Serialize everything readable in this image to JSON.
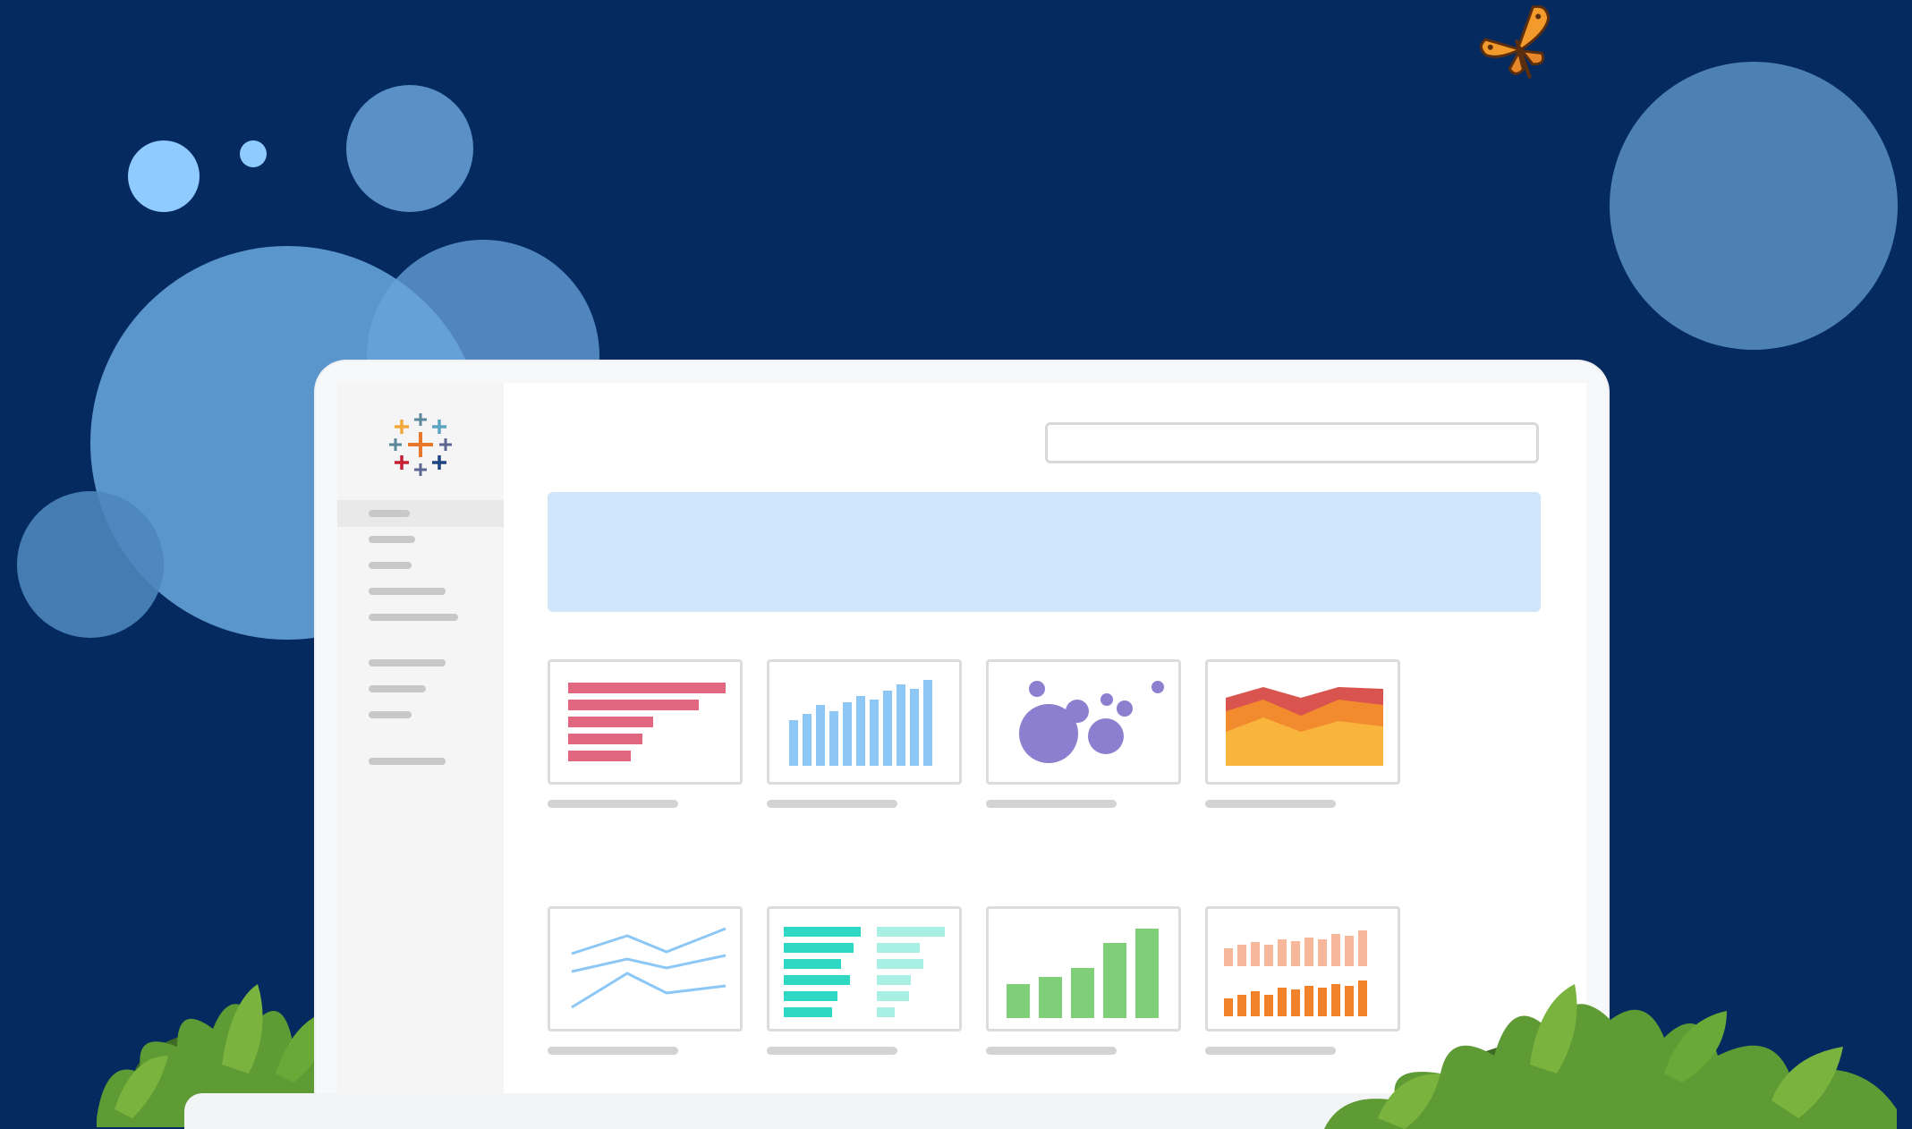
{
  "colors": {
    "background": "#042a60",
    "bubble_light": "#8fcbff",
    "bubble_mid": "#6aa3d8",
    "banner": "#cfe5f9",
    "bar_red": "#e0677f",
    "bar_blue": "#8cc7f5",
    "bubble_purple": "#8c7fd0",
    "area_red": "#d9534f",
    "area_orange": "#f28a2e",
    "area_yellow": "#f9b43c",
    "line_blue": "#8cc7f5",
    "teal": "#2ed8c3",
    "teal_light": "#a8efe4",
    "green": "#7fce78",
    "orange": "#f2822a",
    "peach": "#f7b79b"
  },
  "icons": {
    "logo": "tableau-logo-icon",
    "butterfly": "butterfly-icon",
    "foliage": "bush-icon"
  },
  "search": {
    "placeholder": ""
  },
  "thumbnails": [
    {
      "kind": "horizontal-bar"
    },
    {
      "kind": "vertical-bar"
    },
    {
      "kind": "bubble"
    },
    {
      "kind": "stacked-area"
    },
    {
      "kind": "line"
    },
    {
      "kind": "divergent-bar"
    },
    {
      "kind": "ascending-bar"
    },
    {
      "kind": "stacked-column"
    }
  ]
}
